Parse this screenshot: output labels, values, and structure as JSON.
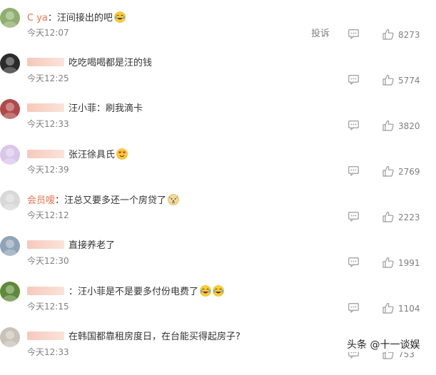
{
  "comments": [
    {
      "username": "C       ya",
      "separator": "：",
      "text": "汪间接出的吧",
      "emoji": [
        "laugh-cry"
      ],
      "time": "今天12:07",
      "report_label": "投诉",
      "likes": "8273",
      "avatar_color": "#8fae6f"
    },
    {
      "username": "",
      "separator": "",
      "text": "吃吃喝喝都是汪的钱",
      "emoji": [],
      "time": "今天12:25",
      "report_label": "",
      "likes": "5774",
      "avatar_color": "#2b2b2b"
    },
    {
      "username": "",
      "separator": "",
      "text": "汪小菲：刷我滴卡",
      "emoji": [],
      "time": "今天12:33",
      "report_label": "",
      "likes": "3820",
      "avatar_color": "#b04a4a"
    },
    {
      "username": "",
      "separator": "",
      "text": "张汪徐具氏",
      "emoji": [
        "heart-eyes"
      ],
      "time": "今天12:39",
      "report_label": "",
      "likes": "2769",
      "avatar_color": "#d9c6e8"
    },
    {
      "username": "会员嗳",
      "separator": "：",
      "text": "汪总又要多还一个房贷了",
      "emoji": [
        "doge"
      ],
      "time": "今天12:12",
      "report_label": "",
      "likes": "2223",
      "avatar_color": "#d8d8d8"
    },
    {
      "username": "",
      "separator": "",
      "text": "直接养老了",
      "emoji": [],
      "time": "今天12:30",
      "report_label": "",
      "likes": "1991",
      "avatar_color": "#8fa4b8"
    },
    {
      "username": "",
      "separator": "：",
      "text": "汪小菲是不是要多付份电费了",
      "emoji": [
        "laugh-cry",
        "laugh-cry"
      ],
      "time": "今天12:15",
      "report_label": "",
      "likes": "1104",
      "avatar_color": "#5f8a3a"
    },
    {
      "username": "",
      "separator": "",
      "text": "在韩国都靠租房度日，在台能买得起房子?",
      "emoji": [],
      "time": "今天12:33",
      "report_label": "",
      "likes": "753",
      "avatar_color": "#c9c2b8"
    }
  ],
  "watermark": "头条 @十一谈娱",
  "colors": {
    "username": "#eb7350",
    "meta": "#808080",
    "text": "#333333"
  }
}
